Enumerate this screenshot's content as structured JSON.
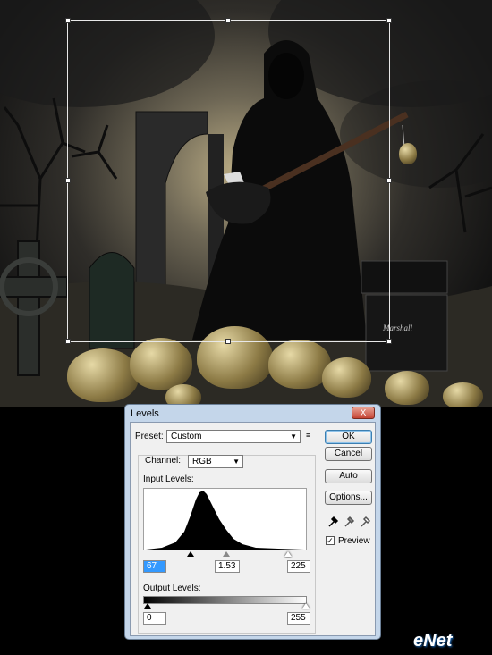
{
  "dialog": {
    "title": "Levels",
    "close_glyph": "X",
    "preset_label": "Preset:",
    "preset_value": "Custom",
    "channel_label": "Channel:",
    "channel_value": "RGB",
    "input_levels_label": "Input Levels:",
    "input_black": "67",
    "input_gamma": "1.53",
    "input_white": "225",
    "output_levels_label": "Output Levels:",
    "output_black": "0",
    "output_white": "255",
    "buttons": {
      "ok": "OK",
      "cancel": "Cancel",
      "auto": "Auto",
      "options": "Options..."
    },
    "preview_label": "Preview",
    "preview_checked": true,
    "eyedroppers": [
      "black-point-eyedropper-icon",
      "gray-point-eyedropper-icon",
      "white-point-eyedropper-icon"
    ]
  },
  "watermark": "eNet",
  "colors": {
    "dialog_frame": "#c4d6ea",
    "dialog_body": "#f0f0f0",
    "selected_field": "#3399ff"
  }
}
